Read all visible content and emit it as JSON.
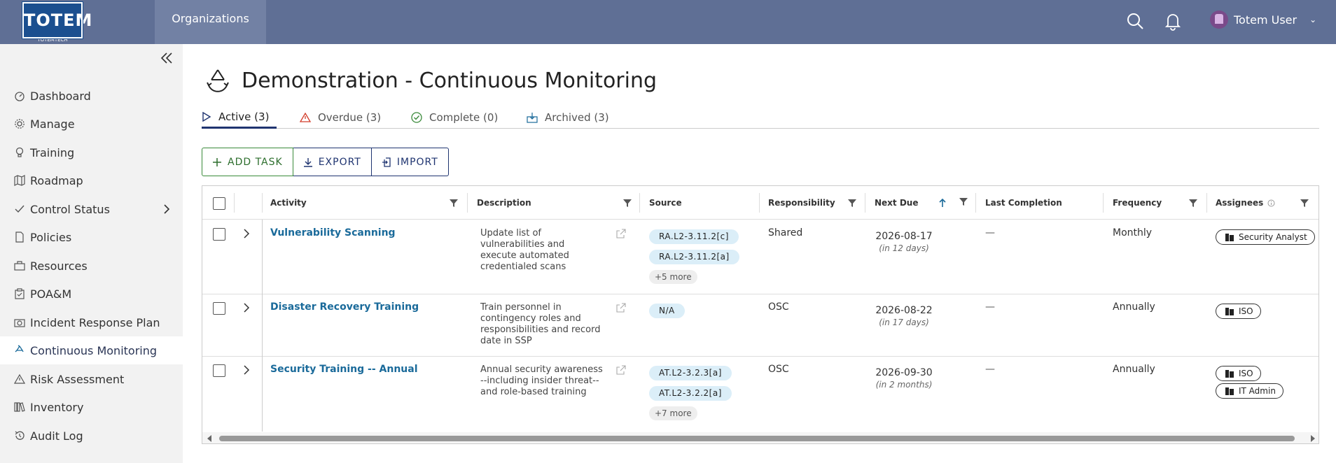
{
  "brand": {
    "logo_text": "TOTEM",
    "logo_sub": "TOTEMTECH"
  },
  "topbar": {
    "org_tab": "Organizations",
    "user_name": "Totem User",
    "icons": [
      "search-icon",
      "bell-icon",
      "chevron-down-icon"
    ]
  },
  "sidebar": {
    "items": [
      {
        "label": "Dashboard",
        "icon": "dashboard-icon"
      },
      {
        "label": "Manage",
        "icon": "gear-icon"
      },
      {
        "label": "Training",
        "icon": "lightbulb-icon"
      },
      {
        "label": "Roadmap",
        "icon": "map-icon"
      },
      {
        "label": "Control Status",
        "icon": "check-icon"
      },
      {
        "label": "Policies",
        "icon": "document-icon"
      },
      {
        "label": "Resources",
        "icon": "briefcase-icon"
      },
      {
        "label": "POA&M",
        "icon": "clipboard-icon"
      },
      {
        "label": "Incident Response Plan",
        "icon": "camera-icon"
      },
      {
        "label": "Continuous Monitoring",
        "icon": "recycle-icon",
        "active": true
      },
      {
        "label": "Risk Assessment",
        "icon": "warning-icon"
      },
      {
        "label": "Inventory",
        "icon": "books-icon"
      },
      {
        "label": "Audit Log",
        "icon": "history-icon"
      }
    ]
  },
  "page": {
    "title": "Demonstration - Continuous Monitoring"
  },
  "tabs": [
    {
      "label": "Active (3)",
      "active": true,
      "icon": "play-icon"
    },
    {
      "label": "Overdue (3)",
      "icon": "warning-icon"
    },
    {
      "label": "Complete (0)",
      "icon": "check-circle-icon"
    },
    {
      "label": "Archived (3)",
      "icon": "archive-icon"
    }
  ],
  "actions": {
    "add": "ADD TASK",
    "export": "EXPORT",
    "import": "IMPORT"
  },
  "table": {
    "columns": [
      "Activity",
      "Description",
      "Source",
      "Responsibility",
      "Next Due",
      "Last Completion",
      "Frequency",
      "Assignees"
    ],
    "rows": [
      {
        "activity": "Vulnerability Scanning",
        "description": "Update list of vulnerabilities and execute automated credentialed scans",
        "sources": [
          "RA.L2-3.11.2[c]",
          "RA.L2-3.11.2[a]"
        ],
        "more": "+5 more",
        "responsibility": "Shared",
        "next_due": "2026-08-17",
        "next_due_rel": "(in 12 days)",
        "last_completion": "—",
        "frequency": "Monthly",
        "assignees": [
          "Security Analyst"
        ]
      },
      {
        "activity": "Disaster Recovery Training",
        "description": "Train personnel in contingency roles and responsibilities and record date in SSP",
        "sources": [
          "N/A"
        ],
        "more": "",
        "responsibility": "OSC",
        "next_due": "2026-08-22",
        "next_due_rel": "(in 17 days)",
        "last_completion": "—",
        "frequency": "Annually",
        "assignees": [
          "ISO"
        ]
      },
      {
        "activity": "Security Training -- Annual",
        "description": "Annual security awareness --including insider threat-- and role-based training",
        "sources": [
          "AT.L2-3.2.3[a]",
          "AT.L2-3.2.2[a]"
        ],
        "more": "+7 more",
        "responsibility": "OSC",
        "next_due": "2026-09-30",
        "next_due_rel": "(in 2 months)",
        "last_completion": "—",
        "frequency": "Annually",
        "assignees": [
          "ISO",
          "IT Admin"
        ]
      }
    ]
  },
  "colors": {
    "topbar": "#5f6f95",
    "accent": "#1f3470",
    "link": "#1a6a9a",
    "add_green": "#2d6e2d",
    "tag_bg": "#dbeef8"
  }
}
